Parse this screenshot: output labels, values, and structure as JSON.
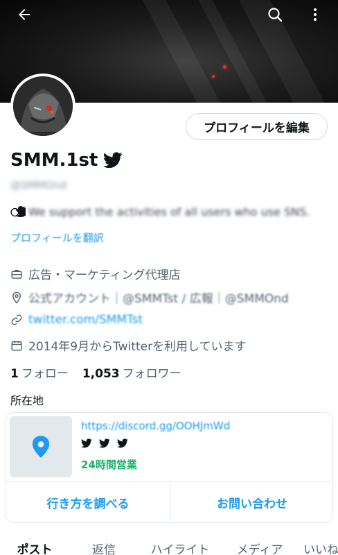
{
  "header": {
    "back_icon": "arrow-left-icon",
    "search_icon": "search-icon",
    "more_icon": "more-vertical-icon"
  },
  "profile": {
    "edit_button": "プロフィールを編集",
    "display_name": "SMM.1st",
    "handle": "@SMMOnd",
    "bio": "We support the activities of all users who use SNS.",
    "translate": "プロフィールを翻訳",
    "category": "広告・マーケティング代理店",
    "location": "公式アカウント｜@SMMTst / 広報｜@SMMOnd",
    "link": "twitter.com/SMMTst",
    "joined": "2014年9月からTwitterを利用しています",
    "following_count": "1",
    "following_label": "フォロー",
    "followers_count": "1,053",
    "followers_label": "フォロワー"
  },
  "location_card": {
    "title": "所在地",
    "url": "https://discord.gg/OOHJmWd",
    "hours": "24時間営業",
    "directions_button": "行き方を調べる",
    "contact_button": "お問い合わせ"
  },
  "tabs": [
    "ポスト",
    "返信",
    "ハイライト",
    "メディア",
    "いいね"
  ],
  "colors": {
    "accent": "#1d9bf0",
    "open_status": "#17b26a",
    "text_primary": "#0f1419",
    "text_secondary": "#536471"
  }
}
